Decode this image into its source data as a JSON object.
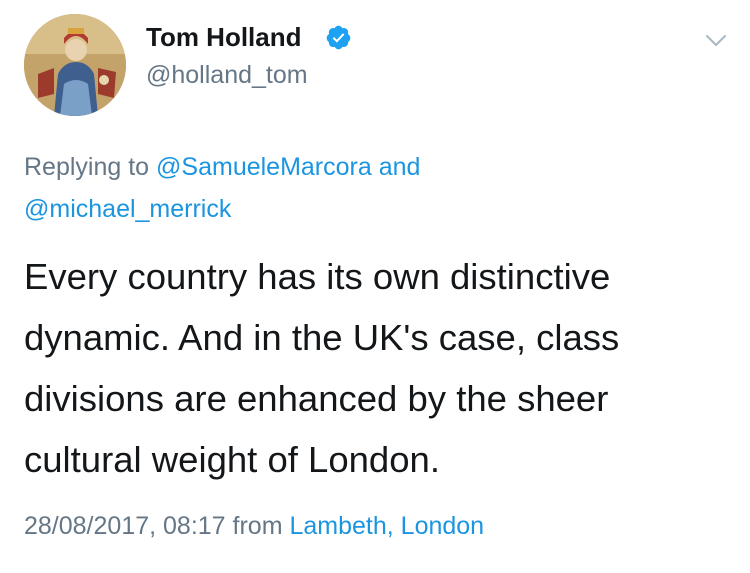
{
  "author": {
    "name": "Tom Holland",
    "handle": "@holland_tom",
    "verified": true
  },
  "reply": {
    "prefix": "Replying to",
    "mention_1": "@SamueleMarcora",
    "joiner": "and",
    "mention_2": "@michael_merrick"
  },
  "tweet": {
    "lines": [
      "Every country has its own distinctive",
      "dynamic. And in the UK's case, class",
      "divisions are enhanced by the sheer",
      "cultural weight of London."
    ]
  },
  "meta": {
    "timestamp": "28/08/2017, 08:17",
    "from_label": "from",
    "location": "Lambeth, London"
  },
  "icons": {
    "verified": "verified-badge-icon",
    "menu": "chevron-down-icon"
  },
  "colors": {
    "text": "#14171a",
    "secondary": "#657786",
    "link": "#1b95e0",
    "verified": "#1da1f2"
  }
}
